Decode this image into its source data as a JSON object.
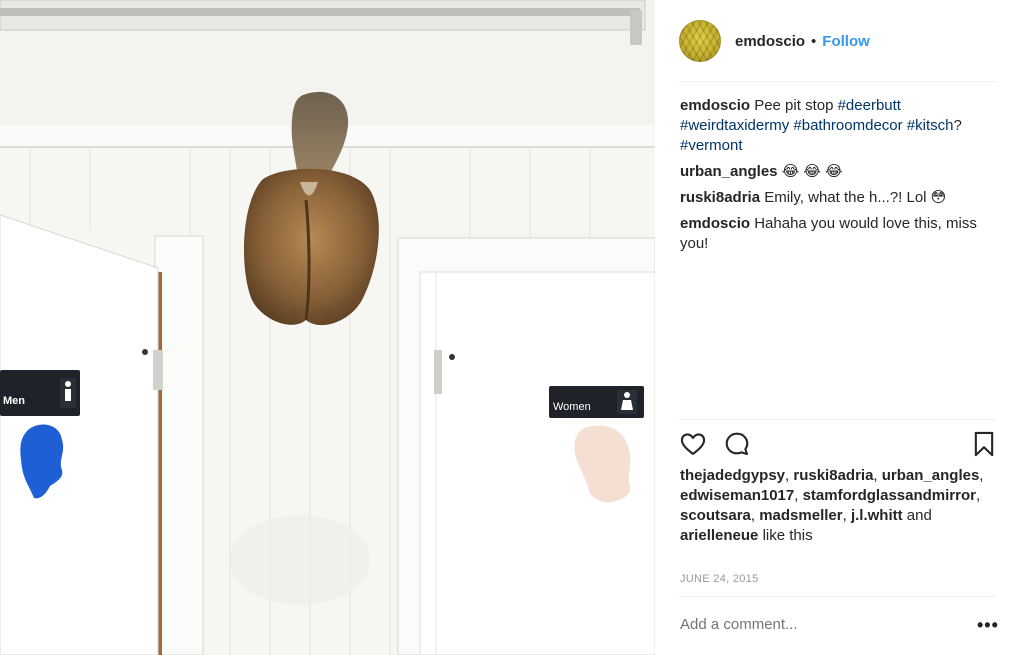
{
  "post": {
    "username": "emdoscio",
    "separator": "•",
    "follow_label": "Follow",
    "photo": {
      "sign_left": "Men",
      "sign_right": "Women"
    }
  },
  "comments": [
    {
      "user": "emdoscio",
      "segments": [
        {
          "text": "Pee pit stop "
        },
        {
          "text": "#deerbutt",
          "tag": true
        },
        {
          "text": " "
        },
        {
          "text": "#weirdtaxidermy",
          "tag": true
        },
        {
          "text": " "
        },
        {
          "text": "#bathroomdecor",
          "tag": true
        },
        {
          "text": " "
        },
        {
          "text": "#kitsch",
          "tag": true
        },
        {
          "text": "? "
        },
        {
          "text": "#vermont",
          "tag": true
        }
      ]
    },
    {
      "user": "urban_angles",
      "segments": [
        {
          "text": "😂 😂 😂"
        }
      ]
    },
    {
      "user": "ruski8adria",
      "segments": [
        {
          "text": "Emily, what the h...?! Lol 😳"
        }
      ]
    },
    {
      "user": "emdoscio",
      "segments": [
        {
          "text": "Hahaha you would love this, miss you!"
        }
      ]
    }
  ],
  "likes": {
    "users": [
      "thejadedgypsy",
      "ruski8adria",
      "urban_angles",
      "edwiseman1017",
      "stamfordglassandmirror",
      "scoutsara",
      "madsmeller",
      "j.l.whitt"
    ],
    "last_user": "arielleneue",
    "and_word": "and",
    "suffix": "like this"
  },
  "date": "JUNE 24, 2015",
  "comment_input": {
    "placeholder": "Add a comment..."
  },
  "more_label": "•••",
  "icons": {
    "like": "heart-icon",
    "comment": "comment-bubble-icon",
    "save": "bookmark-icon"
  },
  "colors": {
    "link": "#3897f0",
    "hashtag": "#003569",
    "muted": "#999999",
    "text": "#262626"
  }
}
